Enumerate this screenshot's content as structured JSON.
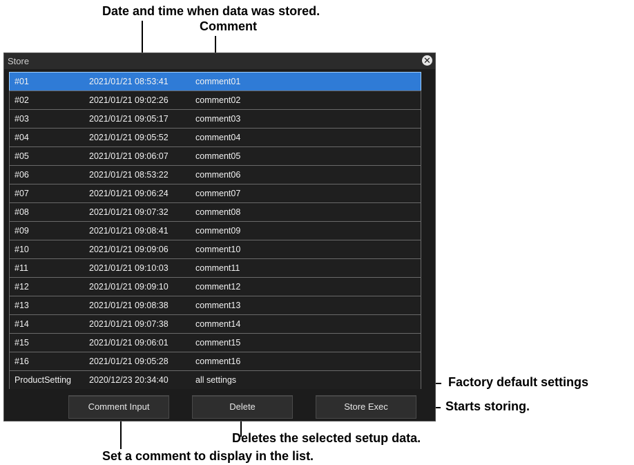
{
  "window": {
    "title": "Store",
    "close_icon": "close-circle-icon"
  },
  "list": {
    "selected_index": 0,
    "rows": [
      {
        "num": "#01",
        "datetime": "2021/01/21  08:53:41",
        "comment": "comment01"
      },
      {
        "num": "#02",
        "datetime": "2021/01/21  09:02:26",
        "comment": "comment02"
      },
      {
        "num": "#03",
        "datetime": "2021/01/21  09:05:17",
        "comment": "comment03"
      },
      {
        "num": "#04",
        "datetime": "2021/01/21  09:05:52",
        "comment": "comment04"
      },
      {
        "num": "#05",
        "datetime": "2021/01/21  09:06:07",
        "comment": "comment05"
      },
      {
        "num": "#06",
        "datetime": "2021/01/21  08:53:22",
        "comment": "comment06"
      },
      {
        "num": "#07",
        "datetime": "2021/01/21  09:06:24",
        "comment": "comment07"
      },
      {
        "num": "#08",
        "datetime": "2021/01/21  09:07:32",
        "comment": "comment08"
      },
      {
        "num": "#09",
        "datetime": "2021/01/21  09:08:41",
        "comment": "comment09"
      },
      {
        "num": "#10",
        "datetime": "2021/01/21  09:09:06",
        "comment": "comment10"
      },
      {
        "num": "#11",
        "datetime": "2021/01/21  09:10:03",
        "comment": "comment11"
      },
      {
        "num": "#12",
        "datetime": "2021/01/21  09:09:10",
        "comment": "comment12"
      },
      {
        "num": "#13",
        "datetime": "2021/01/21  09:08:38",
        "comment": "comment13"
      },
      {
        "num": "#14",
        "datetime": "2021/01/21  09:07:38",
        "comment": "comment14"
      },
      {
        "num": "#15",
        "datetime": "2021/01/21  09:06:01",
        "comment": "comment15"
      },
      {
        "num": "#16",
        "datetime": "2021/01/21  09:05:28",
        "comment": "comment16"
      },
      {
        "num": "ProductSetting",
        "datetime": "2020/12/23  20:34:40",
        "comment": "all settings"
      }
    ]
  },
  "buttons": {
    "comment_input": "Comment Input",
    "delete": "Delete",
    "store_exec": "Store Exec"
  },
  "annotations": {
    "date_time": "Date and time when data was stored.",
    "comment": "Comment",
    "factory_default": "Factory default settings",
    "starts_storing": "Starts storing.",
    "deletes_selected": "Deletes the selected setup data.",
    "set_comment": "Set a comment to display in the list."
  }
}
